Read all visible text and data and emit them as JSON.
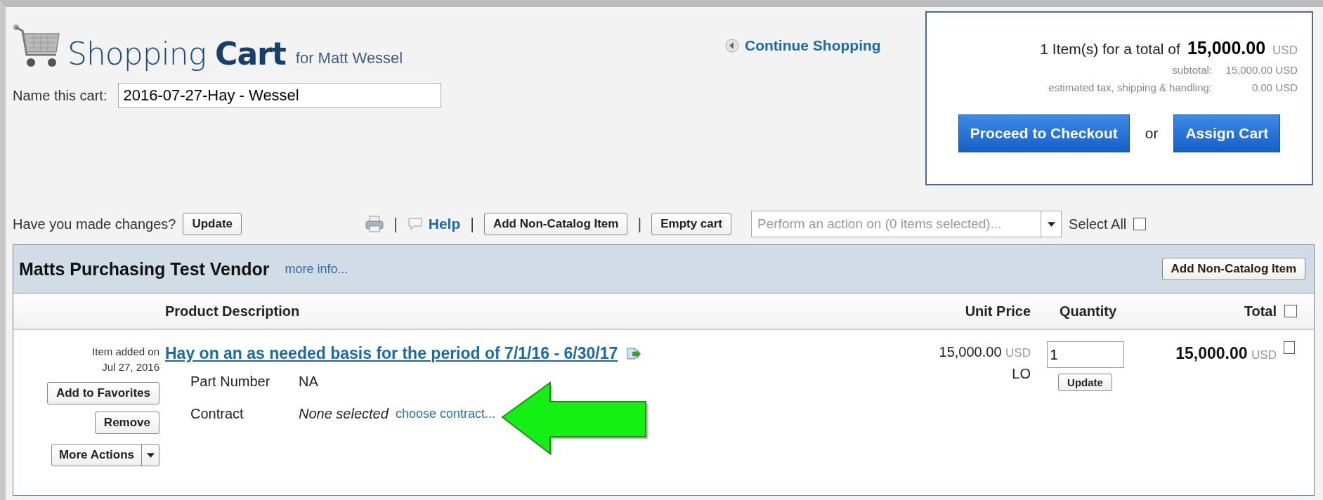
{
  "header": {
    "title_light": "Shopping",
    "title_bold": "Cart",
    "for_user": "for Matt Wessel",
    "cart_name_label": "Name this cart:",
    "cart_name_value": "2016-07-27-Hay - Wessel",
    "continue_link": "Continue Shopping"
  },
  "summary": {
    "items_text": "1 Item(s)  for a total of",
    "total": "15,000.00",
    "total_currency": "USD",
    "lines": [
      {
        "label": "subtotal:",
        "value": "15,000.00 USD"
      },
      {
        "label": "estimated tax, shipping & handling:",
        "value": "0.00 USD"
      }
    ],
    "checkout_button": "Proceed to Checkout",
    "or": "or",
    "assign_button": "Assign Cart"
  },
  "toolbar": {
    "changes_label": "Have you made changes?",
    "update_button": "Update",
    "actions": [
      {
        "kind": "print"
      },
      {
        "kind": "separator",
        "text": "|"
      },
      {
        "kind": "help",
        "text": "Help"
      },
      {
        "kind": "separator",
        "text": "|"
      },
      {
        "kind": "button",
        "text": "Add Non-Catalog Item"
      },
      {
        "kind": "separator",
        "text": "|"
      },
      {
        "kind": "button",
        "text": "Empty cart"
      }
    ],
    "action_select": {
      "placeholder": "Perform an action on (0 items selected)..."
    },
    "select_all": {
      "label": "Select All",
      "checked": false
    }
  },
  "vendor": {
    "name": "Matts Purchasing Test Vendor",
    "more_info": "more info...",
    "add_button": "Add Non-Catalog Item"
  },
  "columns": [
    "Product Description",
    "Unit Price",
    "Quantity",
    "Total"
  ],
  "header_select": {
    "checked": false
  },
  "items": [
    {
      "added_label": "Item added on",
      "added_date": "Jul 27, 2016",
      "buttons": [
        "Add to Favorites",
        "Remove"
      ],
      "more_actions": "More Actions",
      "title": "Hay on an as needed basis for the period of 7/1/16 - 6/30/17",
      "details": [
        {
          "label": "Part Number",
          "value": "NA",
          "kind": "plain",
          "highlighted": false
        },
        {
          "label": "Contract",
          "value": "None selected",
          "link": "choose contract...",
          "kind": "contract",
          "highlighted": true
        }
      ],
      "unit_price": "15,000.00",
      "unit_currency": "USD",
      "unit": "LO",
      "quantity": "1",
      "update_button": "Update",
      "total": "15,000.00",
      "total_currency": "USD",
      "checked": false
    }
  ]
}
